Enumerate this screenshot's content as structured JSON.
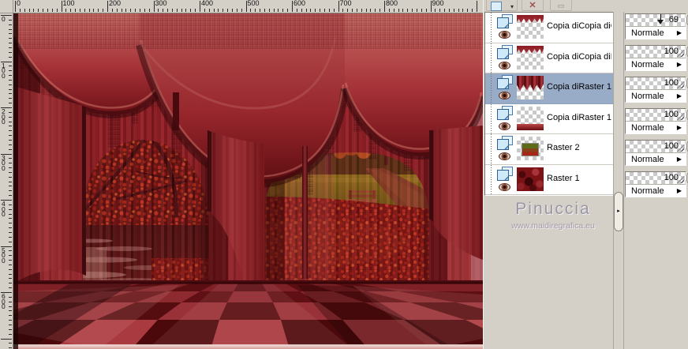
{
  "rulers": {
    "horizontal_labels": [
      "0",
      "100",
      "200",
      "300",
      "400",
      "500",
      "600",
      "700",
      "800",
      "900"
    ],
    "vertical_labels": [
      "0",
      "100",
      "200",
      "300",
      "400",
      "500",
      "600"
    ]
  },
  "layers_palette": {
    "toolbar": {
      "new_layer_glyph": "▾",
      "delete_glyph": "✕",
      "edit_glyph": "▭"
    },
    "dropdown_arrow": "▶",
    "splitter_arrow": "▸",
    "layers": [
      {
        "name": "Copia diCopia diCopi",
        "opacity": "69",
        "blend_mode": "Normale",
        "visible": true,
        "selected": false,
        "thumb": "drips"
      },
      {
        "name": "Copia diCopia diRast",
        "opacity": "100",
        "blend_mode": "Normale",
        "visible": true,
        "selected": false,
        "thumb": "drips"
      },
      {
        "name": "Copia diRaster 1",
        "opacity": "100",
        "blend_mode": "Normale",
        "visible": true,
        "selected": true,
        "thumb": "drapes"
      },
      {
        "name": "Copia diRaster 1",
        "opacity": "100",
        "blend_mode": "Normale",
        "visible": true,
        "selected": false,
        "thumb": "bottomstrip"
      },
      {
        "name": "Raster 2",
        "opacity": "100",
        "blend_mode": "Normale",
        "visible": true,
        "selected": false,
        "thumb": "photo"
      },
      {
        "name": "Raster 1",
        "opacity": "100",
        "blend_mode": "Normale",
        "visible": true,
        "selected": false,
        "thumb": "texture"
      }
    ],
    "watermark": {
      "title": "Pinuccia",
      "url": "www.maidiregrafica.eu"
    }
  },
  "colors": {
    "selection_blue": "#98acc8",
    "panel_gray": "#d4d0c8",
    "drape_red": "#8c2026",
    "floor_dark_red": "#560d10",
    "floor_light_red": "#a03a40"
  }
}
